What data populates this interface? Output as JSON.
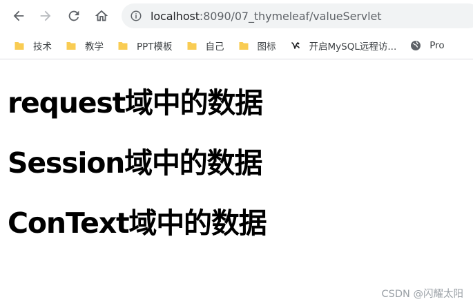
{
  "browser": {
    "url_host": "localhost",
    "url_rest": ":8090/07_thymeleaf/valueServlet",
    "bookmarks": [
      {
        "label": "技术",
        "icon": "folder-icon"
      },
      {
        "label": "教学",
        "icon": "folder-icon"
      },
      {
        "label": "PPT模板",
        "icon": "folder-icon"
      },
      {
        "label": "自己",
        "icon": "folder-icon"
      },
      {
        "label": "图标",
        "icon": "folder-icon"
      },
      {
        "label": "开启MySQL远程访...",
        "icon": "site-icon"
      },
      {
        "label": "Pro",
        "icon": "globe-icon"
      }
    ]
  },
  "page": {
    "headings": [
      "request域中的数据",
      "Session域中的数据",
      "ConText域中的数据"
    ],
    "watermark": "CSDN @闪耀太阳"
  },
  "colors": {
    "folder": "#f9cc53",
    "omnibox_bg": "#f1f3f4",
    "icon": "#5f6368"
  }
}
